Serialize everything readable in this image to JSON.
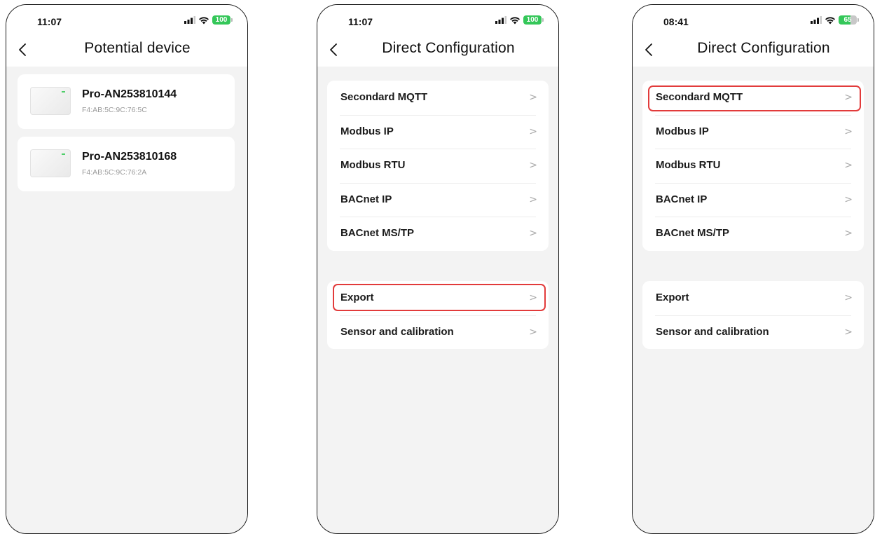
{
  "screens": [
    {
      "time": "11:07",
      "battery": "100",
      "title": "Potential device",
      "devices": [
        {
          "name": "Pro-AN253810144",
          "mac": "F4:AB:5C:9C:76:5C"
        },
        {
          "name": "Pro-AN253810168",
          "mac": "F4:AB:5C:9C:76:2A"
        }
      ]
    },
    {
      "time": "11:07",
      "battery": "100",
      "title": "Direct Configuration",
      "groups": [
        {
          "items": [
            "Secondard MQTT",
            "Modbus IP",
            "Modbus RTU",
            "BACnet IP",
            "BACnet MS/TP"
          ]
        },
        {
          "items": [
            "Export",
            "Sensor and calibration"
          ]
        }
      ],
      "highlighted_item": "Export"
    },
    {
      "time": "08:41",
      "battery": "65",
      "title": "Direct Configuration",
      "groups": [
        {
          "items": [
            "Secondard MQTT",
            "Modbus IP",
            "Modbus RTU",
            "BACnet IP",
            "BACnet MS/TP"
          ]
        },
        {
          "items": [
            "Export",
            "Sensor and calibration"
          ]
        }
      ],
      "highlighted_item": "Secondard MQTT"
    }
  ],
  "colors": {
    "accent_highlight": "#e23b3b",
    "battery_green": "#34c759",
    "page_background": "#f3f3f3"
  },
  "icons": {
    "back": "chevron-left-icon",
    "chevron": "chevron-right-icon",
    "signal": "signal-icon",
    "wifi": "wifi-icon",
    "battery": "battery-icon"
  }
}
